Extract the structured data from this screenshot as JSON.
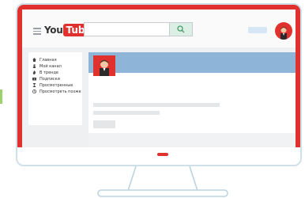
{
  "app": {
    "logo": {
      "you": "You",
      "tube": "Tube"
    }
  },
  "header": {
    "search_placeholder": ""
  },
  "sidebar": {
    "items": [
      {
        "label": "Главная",
        "icon": "home-icon"
      },
      {
        "label": "Мой канал",
        "icon": "person-icon"
      },
      {
        "label": "В тренде",
        "icon": "flame-icon"
      },
      {
        "label": "Подписки",
        "icon": "subscriptions-icon"
      },
      {
        "label": "Просмотренные",
        "icon": "hourglass-icon"
      },
      {
        "label": "Просмотреть позже",
        "icon": "clock-icon"
      }
    ]
  },
  "colors": {
    "brand_red": "#e0312e",
    "banner_blue": "#8eb4d8",
    "search_button": "#dcefe4"
  }
}
